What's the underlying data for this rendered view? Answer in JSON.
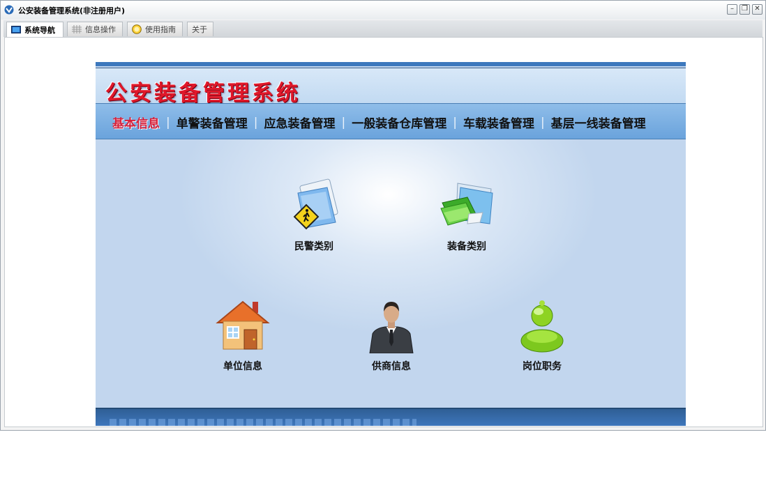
{
  "window": {
    "title": "公安装备管理系统(非注册用户)",
    "controls": [
      "minimize-icon",
      "restore-icon",
      "close-icon"
    ]
  },
  "tabs": [
    {
      "label": "系统导航",
      "icon": "monitor-icon",
      "active": true
    },
    {
      "label": "信息操作",
      "icon": "grid-icon",
      "active": false
    },
    {
      "label": "使用指南",
      "icon": "help-icon",
      "active": false
    },
    {
      "label": "关于",
      "icon": "",
      "active": false
    }
  ],
  "banner": {
    "title": "公安装备管理系统"
  },
  "nav": {
    "items": [
      "基本信息",
      "单警装备管理",
      "应急装备管理",
      "一般装备仓库管理",
      "车载装备管理",
      "基层一线装备管理"
    ],
    "active_index": 0,
    "separator": "|"
  },
  "tiles": [
    {
      "label": "民警类别",
      "icon": "police-folder-icon"
    },
    {
      "label": "装备类别",
      "icon": "equipment-folder-icon"
    },
    {
      "label": "单位信息",
      "icon": "house-icon"
    },
    {
      "label": "供商信息",
      "icon": "businessman-icon"
    },
    {
      "label": "岗位职务",
      "icon": "user-green-icon"
    }
  ],
  "colors": {
    "accent_blue": "#3d78bd",
    "nav_active": "#d6203a",
    "banner_title": "#e0182a"
  }
}
